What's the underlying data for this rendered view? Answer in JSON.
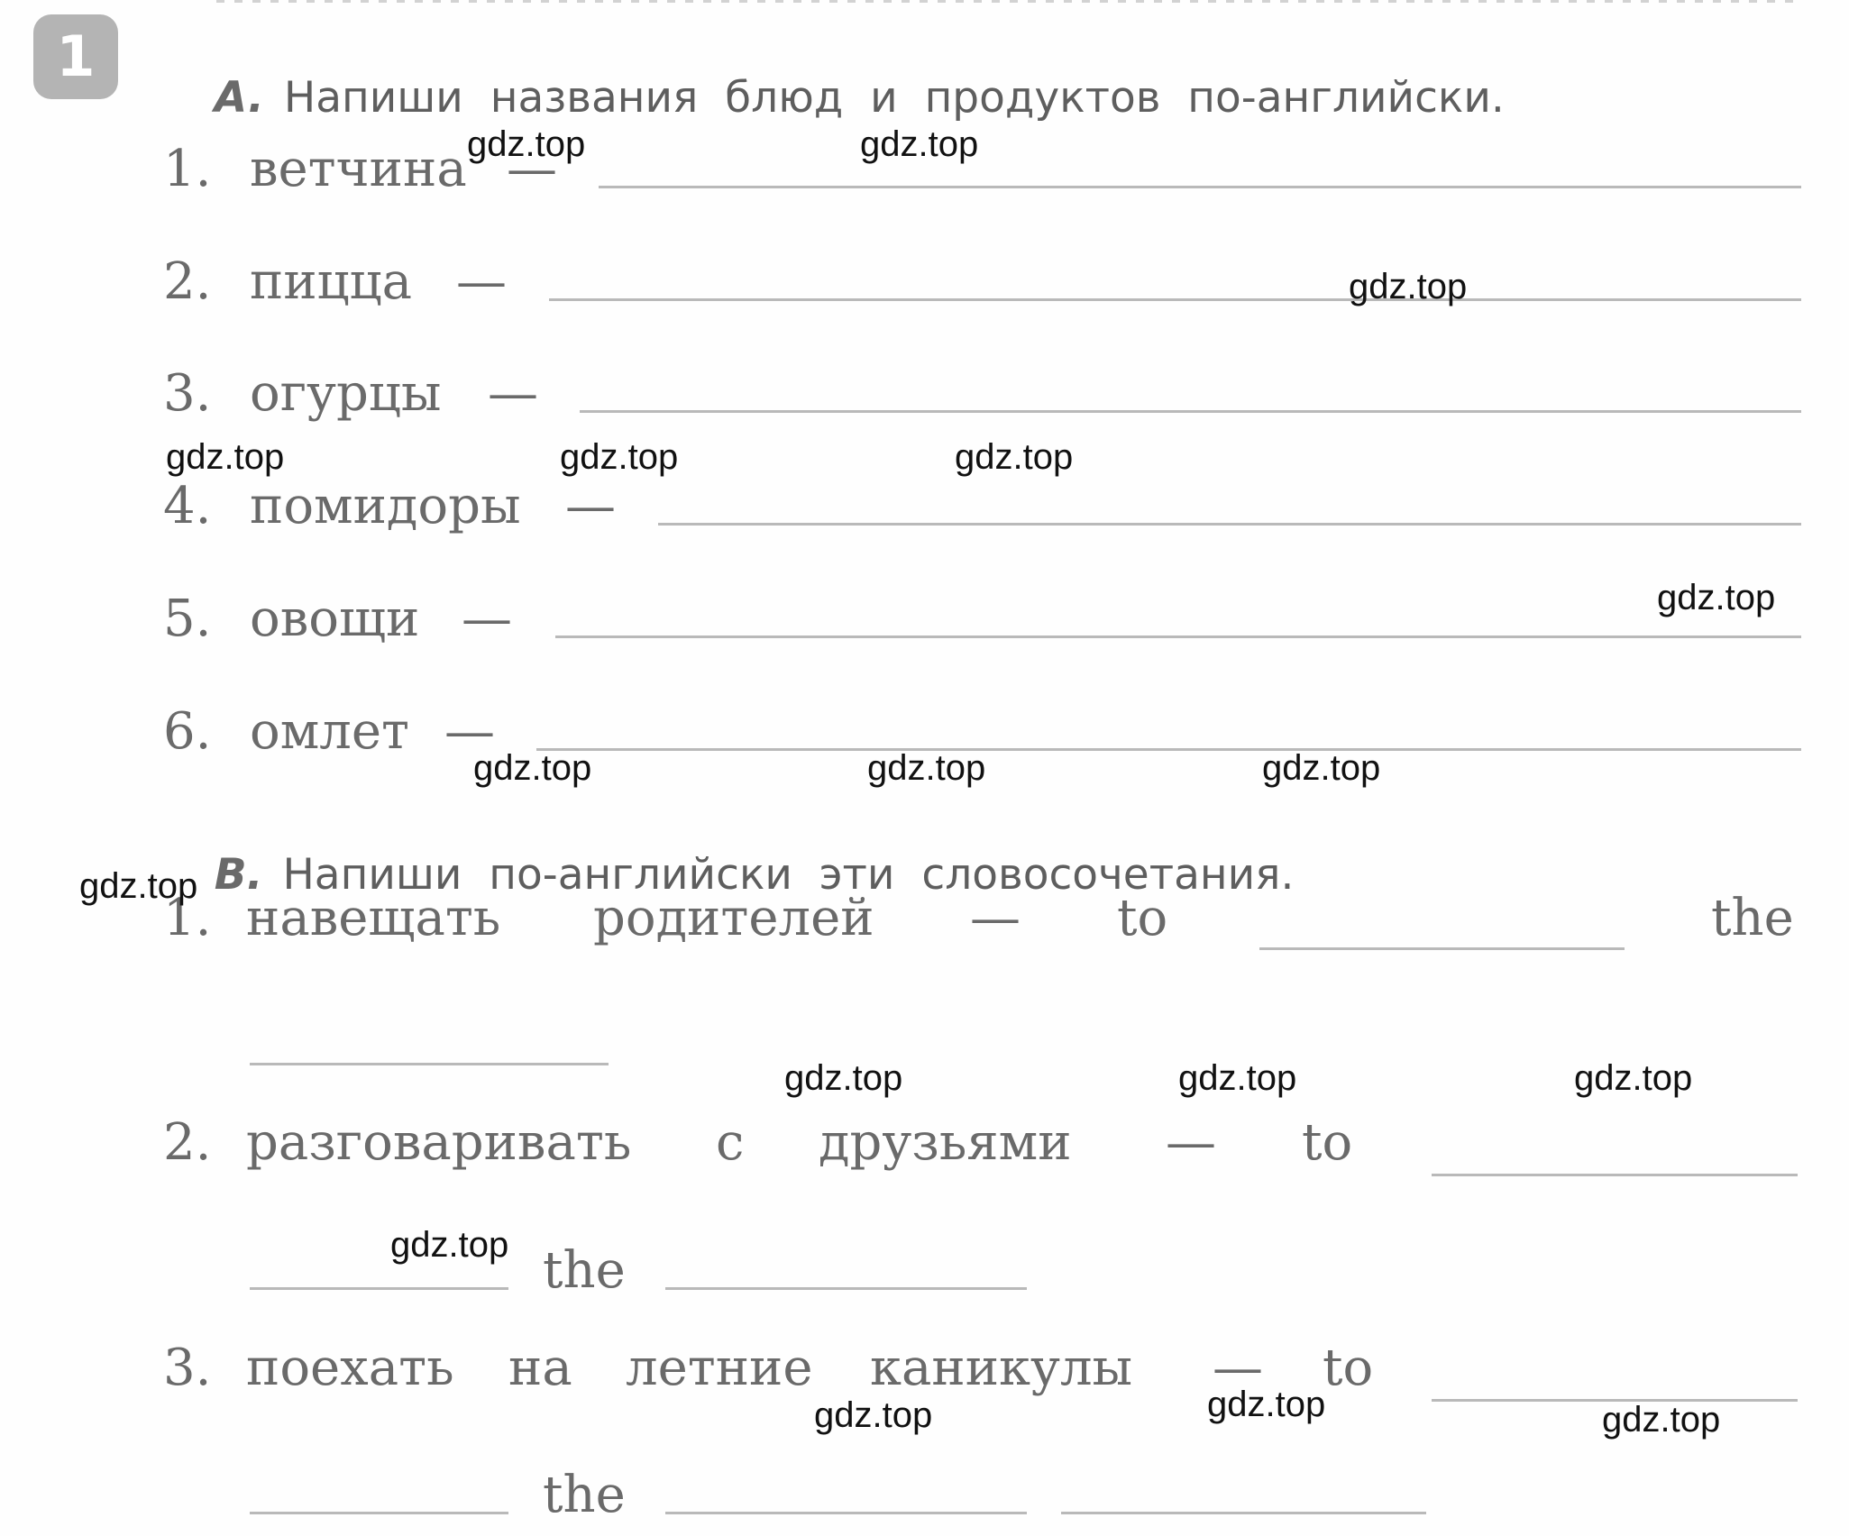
{
  "exercise": {
    "number": "1",
    "number_badge_color": "#b4b4b4",
    "section_a": {
      "letter": "A.",
      "instruction": "Напиши  названия  блюд  и  продуктов  по-английски.",
      "items": [
        {
          "number": "1.",
          "word": "ветчина",
          "dash": "—",
          "answer": ""
        },
        {
          "number": "2.",
          "word": "пицца",
          "dash": "—",
          "answer": ""
        },
        {
          "number": "3.",
          "word": "огурцы",
          "dash": "—",
          "answer": ""
        },
        {
          "number": "4.",
          "word": "помидоры",
          "dash": "—",
          "answer": ""
        },
        {
          "number": "5.",
          "word": "овощи",
          "dash": "—",
          "answer": ""
        },
        {
          "number": "6.",
          "word": "омлет",
          "dash": "—",
          "answer": ""
        }
      ]
    },
    "section_b": {
      "letter": "B.",
      "instruction": "Напиши  по-английски  эти  словосочетания.",
      "items": [
        {
          "number": "1.",
          "words": [
            "навещать",
            "родителей"
          ],
          "dash": "—",
          "to": "to",
          "the": "the",
          "answers": [
            "",
            ""
          ]
        },
        {
          "number": "2.",
          "words": [
            "разговаривать",
            "с",
            "друзьями"
          ],
          "dash": "—",
          "to": "to",
          "the": "the",
          "answers": [
            "",
            "",
            ""
          ]
        },
        {
          "number": "3.",
          "words": [
            "поехать",
            "на",
            "летние",
            "каникулы"
          ],
          "dash": "—",
          "to": "to",
          "the": "the",
          "answers": [
            "",
            "",
            "",
            ""
          ]
        }
      ]
    }
  },
  "watermark": {
    "text": "gdz.top",
    "count": 18
  }
}
